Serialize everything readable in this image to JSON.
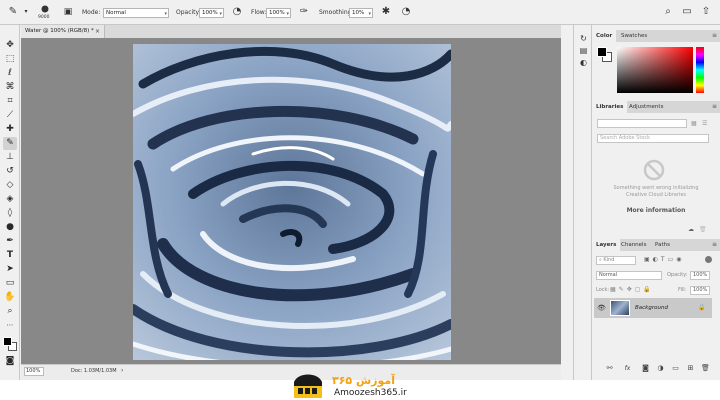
{
  "options_bar": {
    "brush_size": "9000",
    "mode_label": "Mode:",
    "mode_value": "Normal",
    "opacity_label": "Opacity:",
    "opacity_value": "100%",
    "flow_label": "Flow:",
    "flow_value": "100%",
    "smoothing_label": "Smoothing:",
    "smoothing_value": "10%"
  },
  "document": {
    "tab_title": "Water @ 100% (RGB/8) *",
    "close_glyph": "×",
    "zoom": "100%",
    "doc_info": "Doc: 1.03M/1.03M",
    "status_caret": "›"
  },
  "color_panel": {
    "tabs": [
      "Color",
      "Swatches"
    ],
    "accent_hue": "#ff0000"
  },
  "libraries_panel": {
    "tabs": [
      "Libraries",
      "Adjustments"
    ],
    "search_placeholder": "Search Adobe Stock",
    "error_line1": "Something went wrong initializing",
    "error_line2": "Creative Cloud Libraries",
    "more_info": "More information"
  },
  "layers_panel": {
    "tabs": [
      "Layers",
      "Channels",
      "Paths"
    ],
    "kind_label": "Kind",
    "blend_mode": "Normal",
    "opacity_label": "Opacity:",
    "opacity_value": "100%",
    "lock_label": "Lock:",
    "fill_label": "Fill:",
    "fill_value": "100%",
    "layer_name": "Background"
  },
  "footer": {
    "brand_text": "آموزش ۳۶۵",
    "site": "Amoozesh365.ir"
  }
}
